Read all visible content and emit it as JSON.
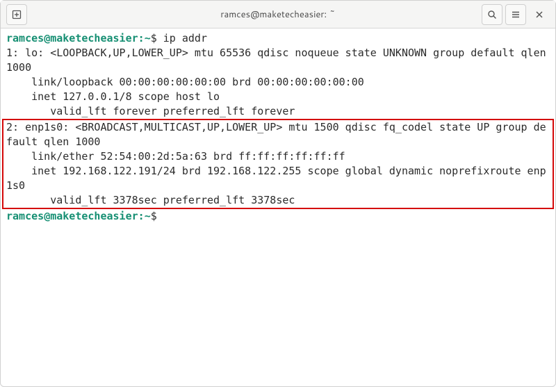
{
  "window": {
    "title": "ramces@maketecheasier: ~"
  },
  "prompt": {
    "user": "ramces",
    "host": "maketecheasier",
    "path": "~",
    "symbol": "$"
  },
  "command": "ip addr",
  "output": {
    "lo": {
      "header": "1: lo: <LOOPBACK,UP,LOWER_UP> mtu 65536 qdisc noqueue state UNKNOWN group default qlen 1000",
      "link": "    link/loopback 00:00:00:00:00:00 brd 00:00:00:00:00:00",
      "inet": "    inet 127.0.0.1/8 scope host lo",
      "valid": "       valid_lft forever preferred_lft forever"
    },
    "enp1s0": {
      "header": "2: enp1s0: <BROADCAST,MULTICAST,UP,LOWER_UP> mtu 1500 qdisc fq_codel state UP group default qlen 1000",
      "link": "    link/ether 52:54:00:2d:5a:63 brd ff:ff:ff:ff:ff:ff",
      "inet": "    inet 192.168.122.191/24 brd 192.168.122.255 scope global dynamic noprefixroute enp1s0",
      "valid": "       valid_lft 3378sec preferred_lft 3378sec"
    }
  }
}
